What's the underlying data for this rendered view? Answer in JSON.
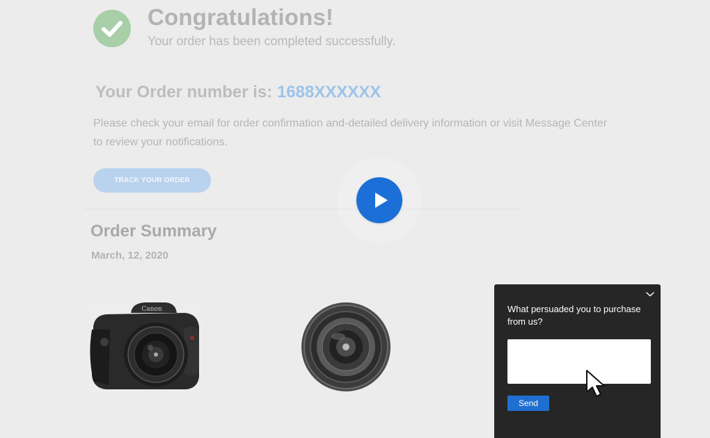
{
  "confirmation": {
    "title": "Congratulations!",
    "subtitle": "Your order has been completed successfully.",
    "order_label": "Your Order number is:",
    "order_number": "1688XXXXXX",
    "info": "Please check your email for order confirmation and-detailed delivery information or visit Message Center to review your notifications.",
    "track_button": "TRACK YOUR ORDER"
  },
  "video": {
    "play_icon": "play-icon",
    "accent_color": "#1b6fd6"
  },
  "summary": {
    "title": "Order Summary",
    "date": "March, 12, 2020",
    "products": [
      {
        "icon": "camera-icon"
      },
      {
        "icon": "lens-icon"
      }
    ]
  },
  "survey": {
    "question": "What persuaded you to purchase from us?",
    "input_value": "",
    "send_label": "Send",
    "collapse_icon": "chevron-down-icon",
    "background": "#262626",
    "button_color": "#1f6fd1"
  },
  "colors": {
    "success": "#a8cfa8",
    "link": "#9cc3ea"
  }
}
